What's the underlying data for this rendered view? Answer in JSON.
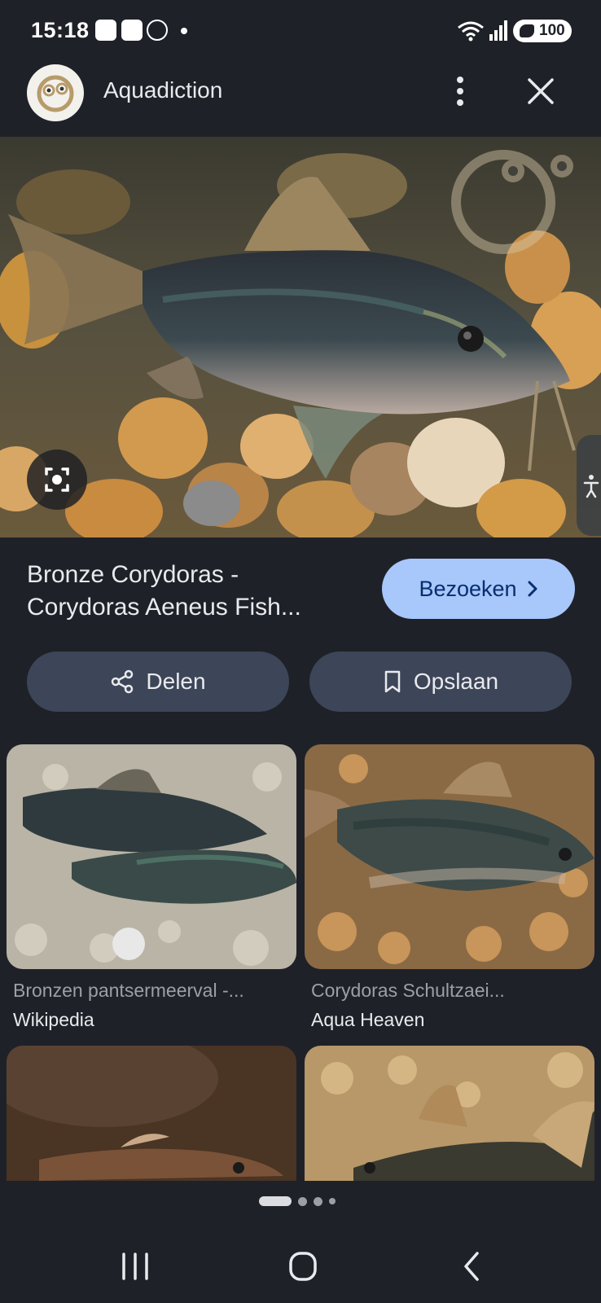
{
  "status_bar": {
    "time": "15:18",
    "battery": "100",
    "icons": [
      "shopping-bag-icon",
      "app-j-icon",
      "vine-app-icon",
      "notification-dot-icon",
      "wifi-icon",
      "signal-icon",
      "battery-icon"
    ]
  },
  "header": {
    "site_name": "Aquadiction",
    "logo_icon": "aquadiction-logo-icon",
    "more_icon": "more-vert-icon",
    "close_icon": "close-icon"
  },
  "hero": {
    "icon": "google-lens-icon",
    "side_icon": "accessibility-icon"
  },
  "result": {
    "title_line1": "Bronze Corydoras -",
    "title_line2": "Corydoras Aeneus Fish...",
    "visit_label": "Bezoeken",
    "share_label": "Delen",
    "save_label": "Opslaan"
  },
  "related": [
    {
      "title": "Bronzen pantsermeerval -...",
      "source": "Wikipedia"
    },
    {
      "title": "Corydoras Schultzaei...",
      "source": "Aqua Heaven"
    },
    {
      "title": "",
      "source": ""
    },
    {
      "title": "",
      "source": ""
    }
  ],
  "pager": {
    "active_index": 0,
    "count": 4
  },
  "colors": {
    "background": "#1f2128",
    "visit_button": "#a8c7fa",
    "action_button": "#3d4558"
  }
}
